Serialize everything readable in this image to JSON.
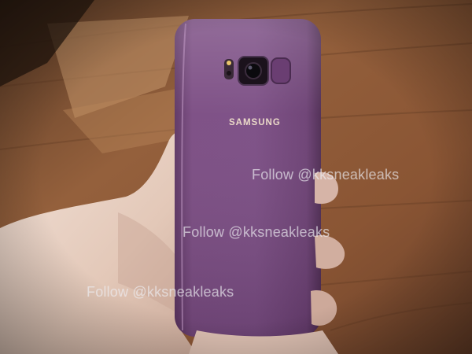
{
  "image": {
    "subject": "back of a purple smartphone held in a hand over a wooden table",
    "colors": {
      "wood": "#8f5a38",
      "wood_light": "#b98558",
      "phone": "#73467a",
      "phone_highlight": "#9a6aa2",
      "skin": "#e9d3c6"
    }
  },
  "phone": {
    "brand_text": "SAMSUNG"
  },
  "watermarks": [
    {
      "text": "Follow @kksneakleaks"
    },
    {
      "text": "Follow @kksneakleaks"
    },
    {
      "text": "Follow @kksneakleaks"
    }
  ]
}
